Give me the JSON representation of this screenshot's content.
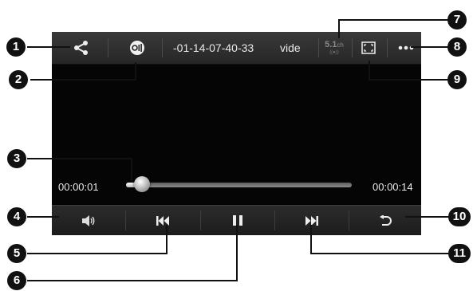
{
  "player": {
    "file_name_visible": "-01-14-07-40-33",
    "file_name_trailing": "vide",
    "audio_badge_main": "5.1",
    "audio_badge_sub": "ch",
    "current_time": "00:00:01",
    "total_time": "00:00:14",
    "progress": 0.07
  },
  "icons": {
    "share": "share-icon",
    "audio_output": "audio-output-icon",
    "surround": "surround-sound-icon",
    "screen_ratio": "screen-ratio-icon",
    "more": "more-options-icon",
    "volume": "volume-icon",
    "previous": "previous-track-icon",
    "pause": "pause-icon",
    "next": "next-track-icon",
    "back": "back-icon"
  },
  "callouts": [
    "1",
    "2",
    "3",
    "4",
    "5",
    "6",
    "7",
    "8",
    "9",
    "10",
    "11"
  ],
  "colors": {
    "screen": "#050505",
    "bar": "#2a2a2a",
    "callout": "#111111"
  }
}
